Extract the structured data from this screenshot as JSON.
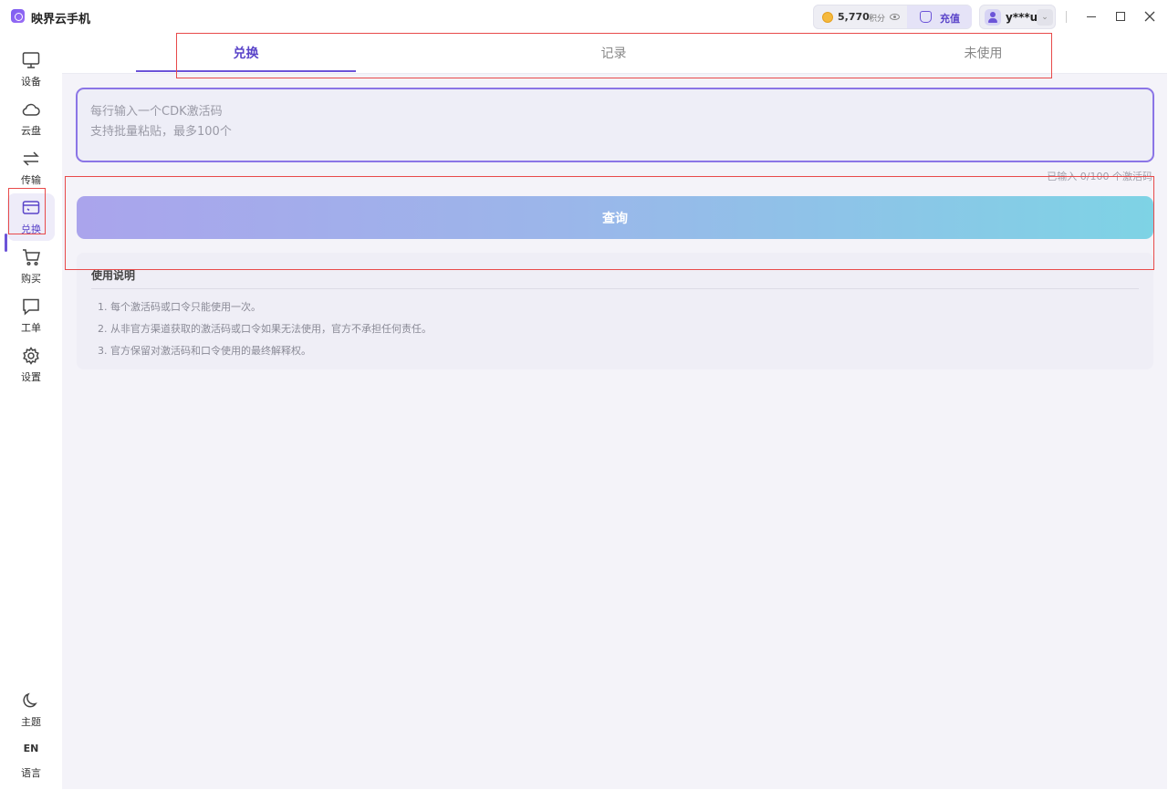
{
  "app": {
    "title": "映界云手机"
  },
  "header": {
    "points_value": "5,770",
    "points_unit": "积分",
    "recharge_label": "充值",
    "username": "y***u"
  },
  "sidebar": {
    "items": [
      {
        "label": "设备",
        "icon": "monitor-icon"
      },
      {
        "label": "云盘",
        "icon": "cloud-icon"
      },
      {
        "label": "传输",
        "icon": "transfer-icon"
      },
      {
        "label": "兑换",
        "icon": "redeem-icon"
      },
      {
        "label": "购买",
        "icon": "cart-icon"
      },
      {
        "label": "工单",
        "icon": "ticket-icon"
      },
      {
        "label": "设置",
        "icon": "gear-icon"
      }
    ],
    "theme_label": "主题",
    "lang_code": "EN",
    "lang_label": "语言"
  },
  "tabs": [
    {
      "label": "兑换"
    },
    {
      "label": "记录"
    },
    {
      "label": "未使用"
    }
  ],
  "redeem": {
    "placeholder": "每行输入一个CDK激活码\n支持批量粘贴，最多100个",
    "counter": "已输入 0/100 个激活码",
    "query_label": "查询"
  },
  "usage": {
    "title": "使用说明",
    "lines": [
      "1. 每个激活码或口令只能使用一次。",
      "2. 从非官方渠道获取的激活码或口令如果无法使用，官方不承担任何责任。",
      "3. 官方保留对激活码和口令使用的最终解释权。"
    ]
  },
  "colors": {
    "accent": "#6c54d8",
    "highlight": "#e84a4a",
    "button_gradient_start": "#aaa4ec",
    "button_gradient_end": "#7ed3e5"
  }
}
